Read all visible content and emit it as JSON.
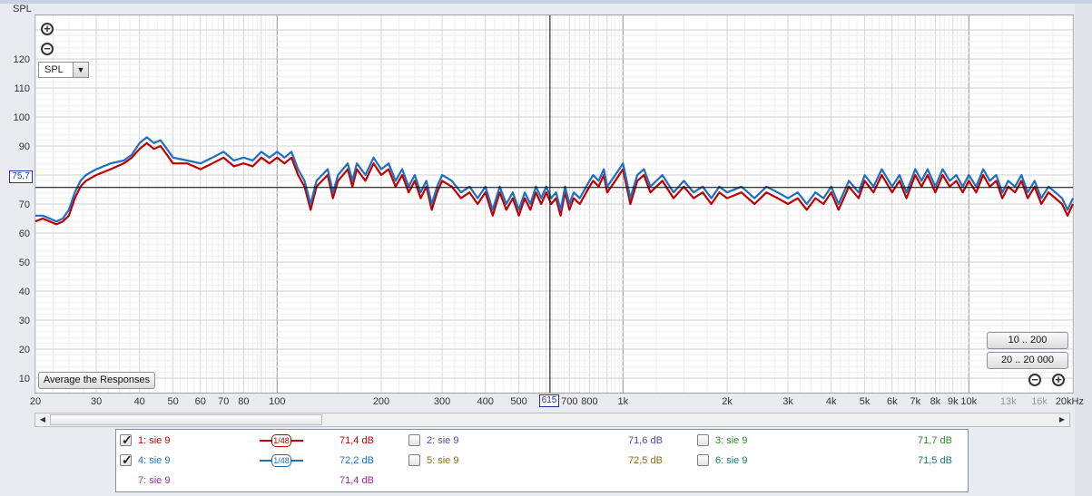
{
  "colors": {
    "trace1": "#c00000",
    "trace4": "#1f6fc0",
    "cursor": "#000000",
    "cursor_label": "#2233aa"
  },
  "y_axis_label": "SPL",
  "view_select": {
    "value": "SPL"
  },
  "buttons": {
    "average": "Average the Responses",
    "range_low": "10 .. 200",
    "range_full": "20 .. 20 000"
  },
  "cursor": {
    "y_value": "75,7",
    "x_value": "615"
  },
  "chart_data": {
    "type": "line",
    "title": "",
    "xlabel": "",
    "ylabel": "SPL",
    "x_scale": "log",
    "xlim": [
      20,
      20000
    ],
    "ylim": [
      5,
      135
    ],
    "y_ticks": [
      10,
      20,
      30,
      40,
      50,
      60,
      70,
      80,
      90,
      100,
      110,
      120
    ],
    "x_ticks": [
      {
        "v": 20,
        "label": "20"
      },
      {
        "v": 30,
        "label": "30"
      },
      {
        "v": 40,
        "label": "40"
      },
      {
        "v": 50,
        "label": "50"
      },
      {
        "v": 60,
        "label": "60"
      },
      {
        "v": 70,
        "label": "70"
      },
      {
        "v": 80,
        "label": "80"
      },
      {
        "v": 100,
        "label": "100"
      },
      {
        "v": 200,
        "label": "200"
      },
      {
        "v": 300,
        "label": "300"
      },
      {
        "v": 400,
        "label": "400"
      },
      {
        "v": 500,
        "label": "500"
      },
      {
        "v": 700,
        "label": "700"
      },
      {
        "v": 800,
        "label": "800"
      },
      {
        "v": 1000,
        "label": "1k"
      },
      {
        "v": 2000,
        "label": "2k"
      },
      {
        "v": 3000,
        "label": "3k"
      },
      {
        "v": 4000,
        "label": "4k"
      },
      {
        "v": 5000,
        "label": "5k"
      },
      {
        "v": 6000,
        "label": "6k"
      },
      {
        "v": 7000,
        "label": "7k"
      },
      {
        "v": 8000,
        "label": "8k"
      },
      {
        "v": 9000,
        "label": "9k"
      },
      {
        "v": 10000,
        "label": "10k"
      },
      {
        "v": 13000,
        "label": "13k"
      },
      {
        "v": 16000,
        "label": "16k"
      },
      {
        "v": 20000,
        "label": "20kHz"
      }
    ],
    "cursor_x": 615,
    "cursor_y": 75.7,
    "grid": true,
    "series": [
      {
        "name": "1: sie 9",
        "color": "#c00000",
        "points": [
          [
            20,
            64
          ],
          [
            21,
            65
          ],
          [
            22,
            64
          ],
          [
            23,
            63
          ],
          [
            24,
            64
          ],
          [
            25,
            66
          ],
          [
            26,
            72
          ],
          [
            27,
            76
          ],
          [
            28,
            78
          ],
          [
            30,
            80
          ],
          [
            33,
            82
          ],
          [
            36,
            84
          ],
          [
            38,
            86
          ],
          [
            40,
            89
          ],
          [
            42,
            91
          ],
          [
            44,
            89
          ],
          [
            46,
            90
          ],
          [
            48,
            87
          ],
          [
            50,
            84
          ],
          [
            55,
            84
          ],
          [
            60,
            82
          ],
          [
            65,
            84
          ],
          [
            70,
            86
          ],
          [
            75,
            83
          ],
          [
            80,
            84
          ],
          [
            85,
            83
          ],
          [
            90,
            86
          ],
          [
            95,
            84
          ],
          [
            100,
            86
          ],
          [
            105,
            84
          ],
          [
            110,
            86
          ],
          [
            115,
            80
          ],
          [
            120,
            76
          ],
          [
            125,
            68
          ],
          [
            130,
            76
          ],
          [
            140,
            80
          ],
          [
            145,
            72
          ],
          [
            150,
            78
          ],
          [
            160,
            82
          ],
          [
            165,
            76
          ],
          [
            170,
            82
          ],
          [
            180,
            78
          ],
          [
            190,
            84
          ],
          [
            200,
            80
          ],
          [
            210,
            82
          ],
          [
            220,
            76
          ],
          [
            230,
            80
          ],
          [
            240,
            74
          ],
          [
            250,
            78
          ],
          [
            260,
            72
          ],
          [
            270,
            76
          ],
          [
            280,
            68
          ],
          [
            290,
            74
          ],
          [
            300,
            78
          ],
          [
            320,
            76
          ],
          [
            340,
            72
          ],
          [
            360,
            74
          ],
          [
            380,
            70
          ],
          [
            400,
            74
          ],
          [
            420,
            66
          ],
          [
            440,
            74
          ],
          [
            460,
            68
          ],
          [
            480,
            72
          ],
          [
            500,
            66
          ],
          [
            520,
            72
          ],
          [
            540,
            68
          ],
          [
            560,
            74
          ],
          [
            580,
            70
          ],
          [
            600,
            74
          ],
          [
            620,
            70
          ],
          [
            640,
            72
          ],
          [
            660,
            66
          ],
          [
            680,
            74
          ],
          [
            700,
            68
          ],
          [
            720,
            72
          ],
          [
            750,
            70
          ],
          [
            800,
            76
          ],
          [
            820,
            78
          ],
          [
            850,
            76
          ],
          [
            880,
            80
          ],
          [
            900,
            74
          ],
          [
            950,
            78
          ],
          [
            1000,
            82
          ],
          [
            1050,
            70
          ],
          [
            1100,
            78
          ],
          [
            1150,
            80
          ],
          [
            1200,
            74
          ],
          [
            1300,
            78
          ],
          [
            1400,
            72
          ],
          [
            1500,
            76
          ],
          [
            1600,
            72
          ],
          [
            1700,
            74
          ],
          [
            1800,
            70
          ],
          [
            1900,
            74
          ],
          [
            2000,
            72
          ],
          [
            2200,
            74
          ],
          [
            2400,
            70
          ],
          [
            2600,
            74
          ],
          [
            2800,
            72
          ],
          [
            3000,
            70
          ],
          [
            3200,
            72
          ],
          [
            3400,
            68
          ],
          [
            3600,
            72
          ],
          [
            3800,
            70
          ],
          [
            4000,
            74
          ],
          [
            4200,
            68
          ],
          [
            4500,
            76
          ],
          [
            4800,
            72
          ],
          [
            5000,
            78
          ],
          [
            5300,
            74
          ],
          [
            5600,
            80
          ],
          [
            6000,
            74
          ],
          [
            6300,
            78
          ],
          [
            6600,
            72
          ],
          [
            7000,
            80
          ],
          [
            7300,
            76
          ],
          [
            7600,
            80
          ],
          [
            8000,
            74
          ],
          [
            8400,
            80
          ],
          [
            8800,
            76
          ],
          [
            9200,
            78
          ],
          [
            9600,
            74
          ],
          [
            10000,
            78
          ],
          [
            10500,
            74
          ],
          [
            11000,
            80
          ],
          [
            11500,
            76
          ],
          [
            12000,
            78
          ],
          [
            12500,
            72
          ],
          [
            13000,
            76
          ],
          [
            13600,
            74
          ],
          [
            14200,
            78
          ],
          [
            14800,
            72
          ],
          [
            15500,
            76
          ],
          [
            16200,
            70
          ],
          [
            17000,
            74
          ],
          [
            17800,
            72
          ],
          [
            18600,
            70
          ],
          [
            19300,
            66
          ],
          [
            20000,
            70
          ]
        ]
      },
      {
        "name": "4: sie 9",
        "color": "#1f6fc0",
        "points": [
          [
            20,
            66
          ],
          [
            21,
            66
          ],
          [
            22,
            65
          ],
          [
            23,
            64
          ],
          [
            24,
            65
          ],
          [
            25,
            68
          ],
          [
            26,
            74
          ],
          [
            27,
            78
          ],
          [
            28,
            80
          ],
          [
            30,
            82
          ],
          [
            33,
            84
          ],
          [
            36,
            85
          ],
          [
            38,
            87
          ],
          [
            40,
            91
          ],
          [
            42,
            93
          ],
          [
            44,
            91
          ],
          [
            46,
            92
          ],
          [
            48,
            89
          ],
          [
            50,
            86
          ],
          [
            55,
            85
          ],
          [
            60,
            84
          ],
          [
            65,
            86
          ],
          [
            70,
            88
          ],
          [
            75,
            85
          ],
          [
            80,
            86
          ],
          [
            85,
            85
          ],
          [
            90,
            88
          ],
          [
            95,
            86
          ],
          [
            100,
            88
          ],
          [
            105,
            86
          ],
          [
            110,
            88
          ],
          [
            115,
            82
          ],
          [
            120,
            78
          ],
          [
            125,
            70
          ],
          [
            130,
            78
          ],
          [
            140,
            82
          ],
          [
            145,
            74
          ],
          [
            150,
            80
          ],
          [
            160,
            84
          ],
          [
            165,
            78
          ],
          [
            170,
            84
          ],
          [
            180,
            80
          ],
          [
            190,
            86
          ],
          [
            200,
            82
          ],
          [
            210,
            84
          ],
          [
            220,
            78
          ],
          [
            230,
            82
          ],
          [
            240,
            76
          ],
          [
            250,
            80
          ],
          [
            260,
            74
          ],
          [
            270,
            78
          ],
          [
            280,
            70
          ],
          [
            290,
            76
          ],
          [
            300,
            80
          ],
          [
            320,
            78
          ],
          [
            340,
            74
          ],
          [
            360,
            76
          ],
          [
            380,
            72
          ],
          [
            400,
            76
          ],
          [
            420,
            68
          ],
          [
            440,
            76
          ],
          [
            460,
            70
          ],
          [
            480,
            74
          ],
          [
            500,
            68
          ],
          [
            520,
            74
          ],
          [
            540,
            70
          ],
          [
            560,
            76
          ],
          [
            580,
            72
          ],
          [
            600,
            76
          ],
          [
            620,
            72
          ],
          [
            640,
            74
          ],
          [
            660,
            68
          ],
          [
            680,
            76
          ],
          [
            700,
            70
          ],
          [
            720,
            74
          ],
          [
            750,
            72
          ],
          [
            800,
            78
          ],
          [
            820,
            80
          ],
          [
            850,
            78
          ],
          [
            880,
            82
          ],
          [
            900,
            76
          ],
          [
            950,
            80
          ],
          [
            1000,
            84
          ],
          [
            1050,
            72
          ],
          [
            1100,
            80
          ],
          [
            1150,
            82
          ],
          [
            1200,
            76
          ],
          [
            1300,
            80
          ],
          [
            1400,
            74
          ],
          [
            1500,
            78
          ],
          [
            1600,
            74
          ],
          [
            1700,
            76
          ],
          [
            1800,
            72
          ],
          [
            1900,
            76
          ],
          [
            2000,
            74
          ],
          [
            2200,
            76
          ],
          [
            2400,
            72
          ],
          [
            2600,
            76
          ],
          [
            2800,
            74
          ],
          [
            3000,
            72
          ],
          [
            3200,
            74
          ],
          [
            3400,
            70
          ],
          [
            3600,
            74
          ],
          [
            3800,
            72
          ],
          [
            4000,
            76
          ],
          [
            4200,
            70
          ],
          [
            4500,
            78
          ],
          [
            4800,
            74
          ],
          [
            5000,
            80
          ],
          [
            5300,
            76
          ],
          [
            5600,
            82
          ],
          [
            6000,
            76
          ],
          [
            6300,
            80
          ],
          [
            6600,
            74
          ],
          [
            7000,
            82
          ],
          [
            7300,
            78
          ],
          [
            7600,
            82
          ],
          [
            8000,
            76
          ],
          [
            8400,
            82
          ],
          [
            8800,
            78
          ],
          [
            9200,
            80
          ],
          [
            9600,
            76
          ],
          [
            10000,
            80
          ],
          [
            10500,
            76
          ],
          [
            11000,
            82
          ],
          [
            11500,
            78
          ],
          [
            12000,
            80
          ],
          [
            12500,
            74
          ],
          [
            13000,
            78
          ],
          [
            13600,
            76
          ],
          [
            14200,
            80
          ],
          [
            14800,
            74
          ],
          [
            15500,
            78
          ],
          [
            16200,
            72
          ],
          [
            17000,
            76
          ],
          [
            17800,
            74
          ],
          [
            18600,
            72
          ],
          [
            19300,
            68
          ],
          [
            20000,
            72
          ]
        ]
      }
    ]
  },
  "legend": [
    {
      "label": "1: sie 9",
      "value": "71,4 dB",
      "checked": true,
      "color": "#c00000",
      "smoothing": "1/48"
    },
    {
      "label": "2: sie 9",
      "value": "71,6 dB",
      "checked": false,
      "color": "#4a4aa8"
    },
    {
      "label": "3: sie 9",
      "value": "71,7 dB",
      "checked": false,
      "color": "#2a8a2a"
    },
    {
      "label": "4: sie 9",
      "value": "72,2 dB",
      "checked": true,
      "color": "#1f6fc0",
      "smoothing": "1/48"
    },
    {
      "label": "5: sie 9",
      "value": "72,5 dB",
      "checked": false,
      "color": "#8a6a10"
    },
    {
      "label": "6: sie 9",
      "value": "71,5 dB",
      "checked": false,
      "color": "#1a7a6a"
    },
    {
      "label": "7: sie 9",
      "value": "71,4 dB",
      "checked": false,
      "color": "#9a2aa0"
    }
  ]
}
